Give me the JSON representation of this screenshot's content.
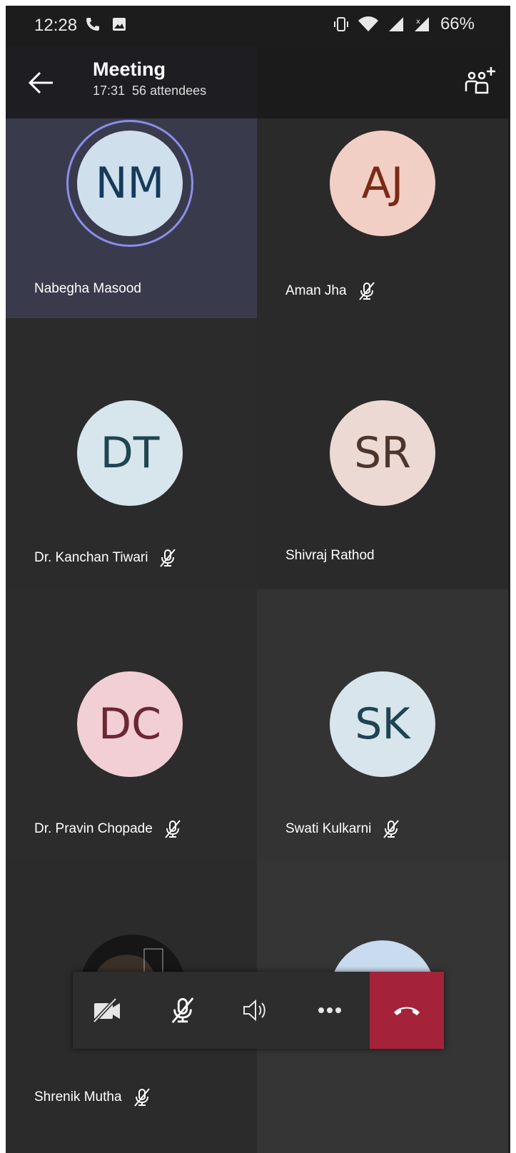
{
  "status_bar": {
    "time": "12:28",
    "battery": "66%"
  },
  "header": {
    "title": "Meeting",
    "duration": "17:31",
    "attendees": "56 attendees"
  },
  "participants": [
    {
      "initials": "NM",
      "name": "Nabegha Masood",
      "muted": false,
      "speaking": true,
      "avatar_bg": "#cfe0ec",
      "initials_color": "#153b5c"
    },
    {
      "initials": "AJ",
      "name": "Aman Jha",
      "muted": true,
      "speaking": false,
      "avatar_bg": "#f2cfc4",
      "initials_color": "#7a2a16"
    },
    {
      "initials": "DT",
      "name": "Dr. Kanchan Tiwari",
      "muted": true,
      "speaking": false,
      "avatar_bg": "#d6e6ec",
      "initials_color": "#1f4550"
    },
    {
      "initials": "SR",
      "name": "Shivraj Rathod",
      "muted": false,
      "speaking": false,
      "avatar_bg": "#ecd9d3",
      "initials_color": "#4e352c"
    },
    {
      "initials": "DC",
      "name": "Dr. Pravin Chopade",
      "muted": true,
      "speaking": false,
      "avatar_bg": "#f2cfd4",
      "initials_color": "#6b2733"
    },
    {
      "initials": "SK",
      "name": "Swati Kulkarni",
      "muted": true,
      "speaking": false,
      "avatar_bg": "#d8e5ec",
      "initials_color": "#1f4452"
    },
    {
      "initials": "",
      "name": "Shrenik Mutha",
      "muted": true,
      "speaking": false,
      "avatar_bg": "#111111",
      "initials_color": "#ffffff"
    },
    {
      "initials": "",
      "name": "",
      "muted": false,
      "speaking": false,
      "avatar_bg": "#c9dbee",
      "initials_color": "#1f4452"
    }
  ],
  "controls": {
    "icons": [
      "camera-off-icon",
      "mic-off-icon",
      "speaker-icon",
      "more-icon",
      "hang-up-icon"
    ],
    "hangup_color": "#a4233a"
  },
  "colors": {
    "background": "#1f1f1f",
    "active_tile": "#3a3a4d",
    "ring": "#8b8ee8"
  }
}
